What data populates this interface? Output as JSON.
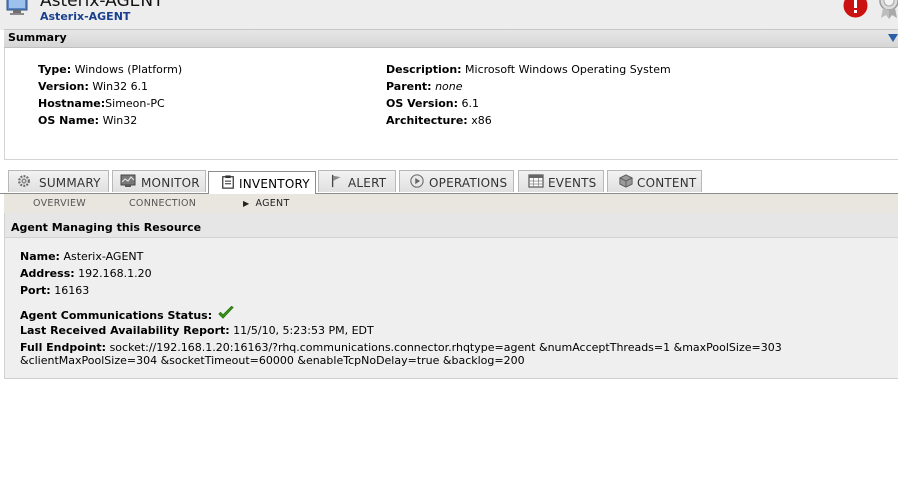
{
  "header": {
    "title": "Asterix-AGENT",
    "subtitle": "Asterix-AGENT"
  },
  "summary": {
    "label": "Summary",
    "left": [
      {
        "key": "Type:",
        "value": "Windows (Platform)"
      },
      {
        "key": "Version:",
        "value": "Win32 6.1"
      },
      {
        "key": "Hostname:",
        "value": "Simeon-PC"
      },
      {
        "key": "OS Name:",
        "value": "Win32"
      }
    ],
    "right": [
      {
        "key": "Description:",
        "value": "Microsoft Windows Operating System"
      },
      {
        "key": "Parent:",
        "value": "none"
      },
      {
        "key": "OS Version:",
        "value": "6.1"
      },
      {
        "key": "Architecture:",
        "value": "x86"
      }
    ]
  },
  "tabs": [
    {
      "label": "SUMMARY",
      "icon": "gear-icon"
    },
    {
      "label": "MONITOR",
      "icon": "monitor-icon"
    },
    {
      "label": "INVENTORY",
      "icon": "clipboard-icon"
    },
    {
      "label": "ALERT",
      "icon": "flag-icon"
    },
    {
      "label": "OPERATIONS",
      "icon": "play-icon"
    },
    {
      "label": "EVENTS",
      "icon": "calendar-icon"
    },
    {
      "label": "CONTENT",
      "icon": "package-icon"
    }
  ],
  "active_tab": "INVENTORY",
  "subtabs": [
    {
      "label": "OVERVIEW"
    },
    {
      "label": "CONNECTION"
    },
    {
      "label": "AGENT"
    }
  ],
  "agent": {
    "heading": "Agent Managing this Resource",
    "name_key": "Name:",
    "name": "Asterix-AGENT",
    "address_key": "Address:",
    "address": "192.168.1.20",
    "port_key": "Port:",
    "port": "16163",
    "status_key": "Agent Communications Status:",
    "status_icon": "check-icon",
    "last_report_key": "Last Received Availability Report:",
    "last_report": "11/5/10, 5:23:53 PM, EDT",
    "endpoint_key": "Full Endpoint:",
    "endpoint": "socket://192.168.1.20:16163/?rhq.communications.connector.rhqtype=agent &numAcceptThreads=1 &maxPoolSize=303 &clientMaxPoolSize=304 &socketTimeout=60000 &enableTcpNoDelay=true &backlog=200"
  },
  "colors": {
    "accent": "#1a3f8f",
    "alert": "#cc1111",
    "check": "#3a9a1a"
  }
}
